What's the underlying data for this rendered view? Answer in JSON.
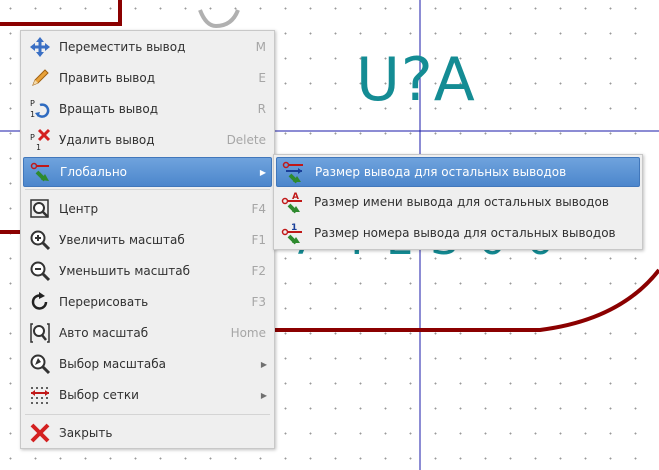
{
  "schematic": {
    "reference": "U?A",
    "value": "74LS00",
    "colors": {
      "wire": "#8b0000",
      "grid_line": "#1a1aa8",
      "text": "#148c94"
    }
  },
  "context_menu": {
    "items": [
      {
        "label": "Переместить вывод",
        "shortcut": "M",
        "icon": "move-icon"
      },
      {
        "label": "Править вывод",
        "shortcut": "E",
        "icon": "pencil-icon"
      },
      {
        "label": "Вращать вывод",
        "shortcut": "R",
        "icon": "rotate-pin-icon"
      },
      {
        "label": "Удалить вывод",
        "shortcut": "Delete",
        "icon": "delete-pin-icon"
      },
      {
        "label": "Глобально",
        "shortcut": "",
        "icon": "global-pin-icon",
        "has_submenu": true,
        "highlighted": true
      },
      {
        "label": "Центр",
        "shortcut": "F4",
        "icon": "zoom-center-icon"
      },
      {
        "label": "Увеличить масштаб",
        "shortcut": "F1",
        "icon": "zoom-in-icon"
      },
      {
        "label": "Уменьшить масштаб",
        "shortcut": "F2",
        "icon": "zoom-out-icon"
      },
      {
        "label": "Перерисовать",
        "shortcut": "F3",
        "icon": "redraw-icon"
      },
      {
        "label": "Авто масштаб",
        "shortcut": "Home",
        "icon": "zoom-fit-icon"
      },
      {
        "label": "Выбор масштаба",
        "shortcut": "",
        "icon": "zoom-select-icon",
        "has_submenu": true
      },
      {
        "label": "Выбор сетки",
        "shortcut": "",
        "icon": "grid-select-icon",
        "has_submenu": true
      },
      {
        "label": "Закрыть",
        "shortcut": "",
        "icon": "close-icon"
      }
    ]
  },
  "submenu": {
    "items": [
      {
        "label": "Размер вывода для остальных выводов",
        "icon": "pin-size-icon",
        "highlighted": true
      },
      {
        "label": "Размер имени вывода для остальных выводов",
        "icon": "pin-name-size-icon"
      },
      {
        "label": "Размер номера вывода для остальных выводов",
        "icon": "pin-number-size-icon"
      }
    ]
  }
}
